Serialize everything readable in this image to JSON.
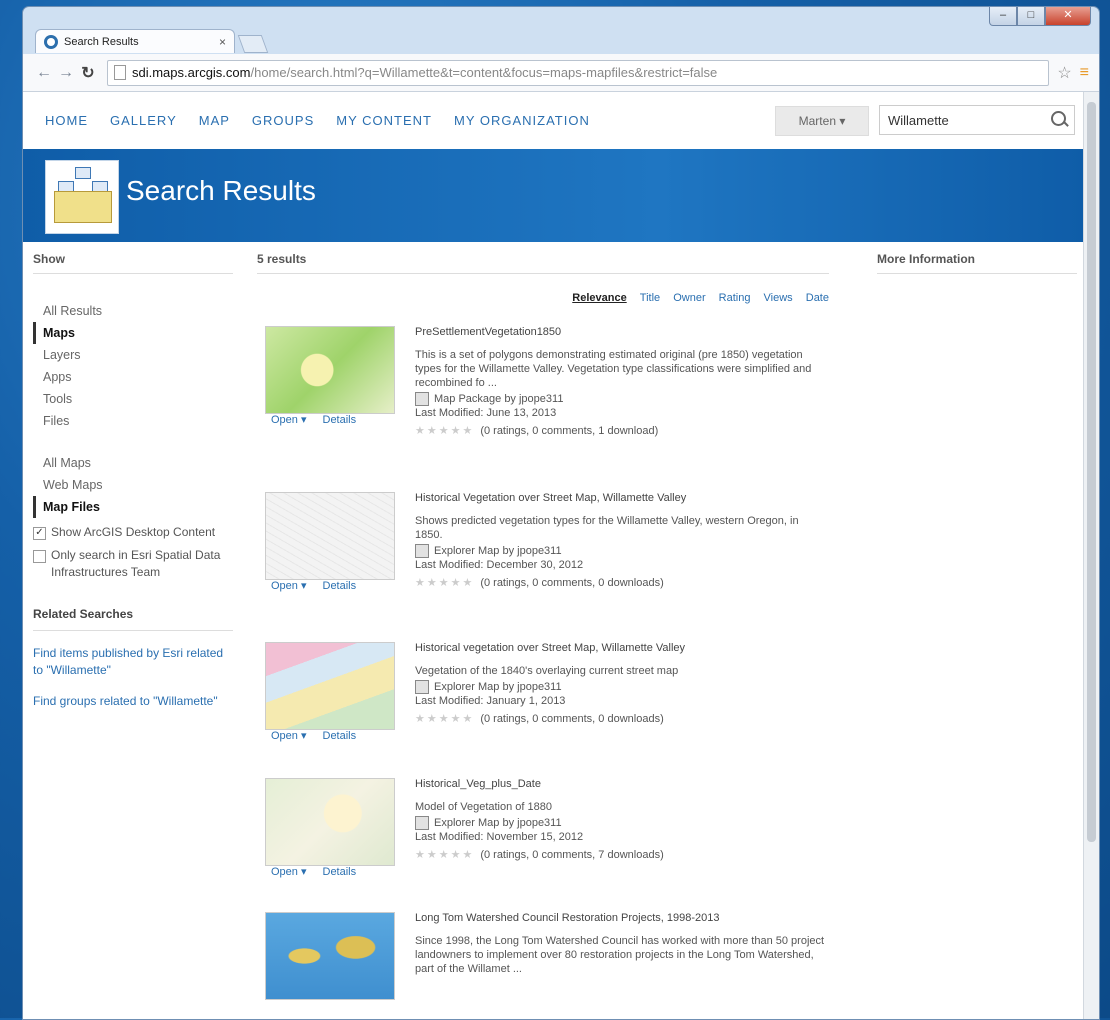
{
  "browser": {
    "tab_title": "Search Results",
    "tab_close": "×",
    "url_host": "sdi.maps.arcgis.com",
    "url_path": "/home/search.html?q=Willamette&t=content&focus=maps-mapfiles&restrict=false",
    "window_min": "–",
    "window_max": "□",
    "window_close": "✕"
  },
  "topnav": {
    "items": [
      "HOME",
      "GALLERY",
      "MAP",
      "GROUPS",
      "MY CONTENT",
      "MY ORGANIZATION"
    ],
    "user": "Marten ▾",
    "search_value": "Willamette"
  },
  "banner": {
    "title": "Search Results"
  },
  "sidebar": {
    "header": "Show",
    "types": [
      "All Results",
      "Maps",
      "Layers",
      "Apps",
      "Tools",
      "Files"
    ],
    "subtypes": [
      "All Maps",
      "Web Maps",
      "Map Files"
    ],
    "show_desktop": "Show ArcGIS Desktop Content",
    "only_esri": "Only search in Esri Spatial Data Infrastructures Team",
    "related_header": "Related Searches",
    "related_link_1": "Find items published by Esri related to \"Willamette\"",
    "related_link_2": "Find groups related to \"Willamette\""
  },
  "main": {
    "count": "5 results",
    "sort": [
      "Relevance",
      "Title",
      "Owner",
      "Rating",
      "Views",
      "Date"
    ],
    "open_label": "Open ▾",
    "details_label": "Details",
    "results": [
      {
        "title": "PreSettlementVegetation1850",
        "snippet": "This is a set of polygons demonstrating estimated original (pre 1850) vegetation types for the Willamette Valley. Vegetation type classifications were simplified and recombined fo ...",
        "type": "Map Package by jpope311",
        "modified": "Last Modified: June 13, 2013",
        "stars": "★★★★★",
        "rating": "(0 ratings, 0 comments, 1 download)"
      },
      {
        "title": "Historical Vegetation over Street Map, Willamette Valley",
        "snippet": "Shows predicted vegetation types for the Willamette Valley, western Oregon, in 1850.",
        "type": "Explorer Map by jpope311",
        "modified": "Last Modified: December 30, 2012",
        "stars": "★★★★★",
        "rating": "(0 ratings, 0 comments, 0 downloads)"
      },
      {
        "title": "Historical vegetation over Street Map, Willamette Valley",
        "snippet": "Vegetation of the 1840's overlaying current street map",
        "type": "Explorer Map by jpope311",
        "modified": "Last Modified: January 1, 2013",
        "stars": "★★★★★",
        "rating": "(0 ratings, 0 comments, 0 downloads)"
      },
      {
        "title": "Historical_Veg_plus_Date",
        "snippet": "Model of Vegetation of 1880",
        "type": "Explorer Map by jpope311",
        "modified": "Last Modified: November 15, 2012",
        "stars": "★★★★★",
        "rating": "(0 ratings, 0 comments, 7 downloads)"
      },
      {
        "title": "Long Tom Watershed Council Restoration Projects, 1998-2013",
        "snippet": "Since 1998, the Long Tom Watershed Council has worked with more than 50 project landowners to implement over 80 restoration projects in the Long Tom Watershed, part of the Willamet ..."
      }
    ]
  },
  "rightcol": {
    "header": "More Information"
  }
}
